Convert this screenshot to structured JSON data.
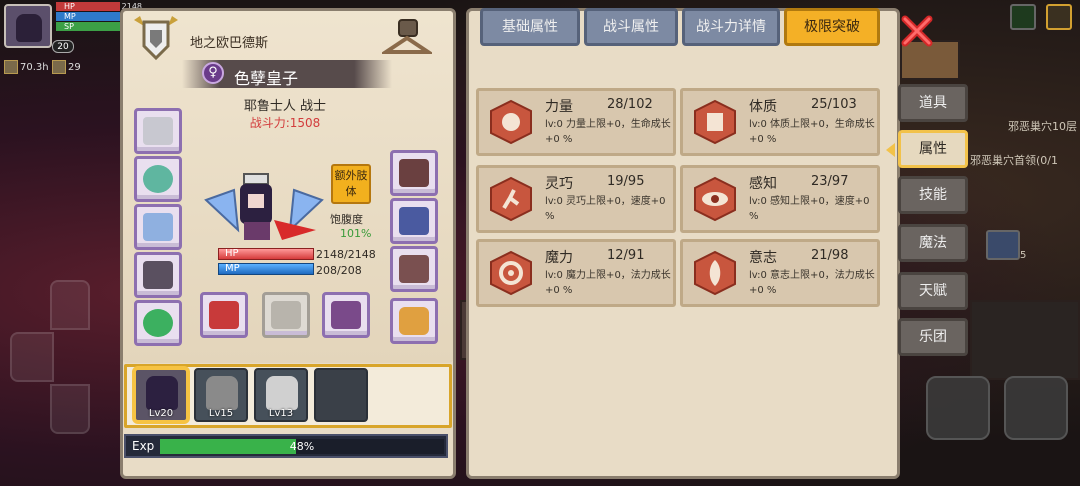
{
  "hud": {
    "hp_label": "HP",
    "mp_label": "MP",
    "sp_label": "SP",
    "hp_value": "2148",
    "level": "20",
    "stat_time": "70.3h",
    "stat_count": "29"
  },
  "world": {
    "map_label_1": "邪恶巢穴10层",
    "map_label_2": "邪恶巢穴首领(0/1",
    "item_count": "5"
  },
  "character": {
    "title": "地之欧巴德斯",
    "name": "色孽皇子",
    "gender_symbol": "♀",
    "class": "耶鲁士人 战士",
    "power": "战斗力:1508",
    "bonus_button": "额外肢体",
    "satiety_label": "饱腹度",
    "satiety_value": "101%",
    "hp_label": "HP",
    "mp_label": "MP",
    "hp_value": "2148/2148",
    "mp_value": "208/208",
    "hp_fraction": 1.0,
    "mp_fraction": 1.0
  },
  "party": [
    {
      "level": "Lv20"
    },
    {
      "level": "Lv15"
    },
    {
      "level": "Lv13"
    },
    {
      "level": ""
    }
  ],
  "exp": {
    "label": "Exp",
    "percent": "48%",
    "fraction": 0.48
  },
  "tabs": [
    "基础属性",
    "战斗属性",
    "战斗力详情",
    "极限突破"
  ],
  "active_tab": "极限突破",
  "side_tabs": [
    "道具",
    "属性",
    "技能",
    "魔法",
    "天赋",
    "乐团"
  ],
  "active_side_tab": "属性",
  "attributes": [
    {
      "name": "力量",
      "value": "28/102",
      "desc": "lv:0 力量上限+0，生命成长+0 %",
      "icon": "muscle-icon"
    },
    {
      "name": "体质",
      "value": "25/103",
      "desc": "lv:0 体质上限+0，生命成长+0 %",
      "icon": "body-icon"
    },
    {
      "name": "灵巧",
      "value": "19/95",
      "desc": "lv:0 灵巧上限+0，速度+0 %",
      "icon": "runner-icon"
    },
    {
      "name": "感知",
      "value": "23/97",
      "desc": "lv:0 感知上限+0，速度+0 %",
      "icon": "eye-icon"
    },
    {
      "name": "魔力",
      "value": "12/91",
      "desc": "lv:0 魔力上限+0，法力成长+0 %",
      "icon": "swirl-icon"
    },
    {
      "name": "意志",
      "value": "21/98",
      "desc": "lv:0 意志上限+0，法力成长+0 %",
      "icon": "will-icon"
    }
  ],
  "colors": {
    "accent_gold": "#f4b026",
    "tab_blue": "#7d8aa3",
    "power_red": "#d23c3c",
    "satiety_green": "#3a9b3a",
    "exp_green": "#39b24a"
  }
}
